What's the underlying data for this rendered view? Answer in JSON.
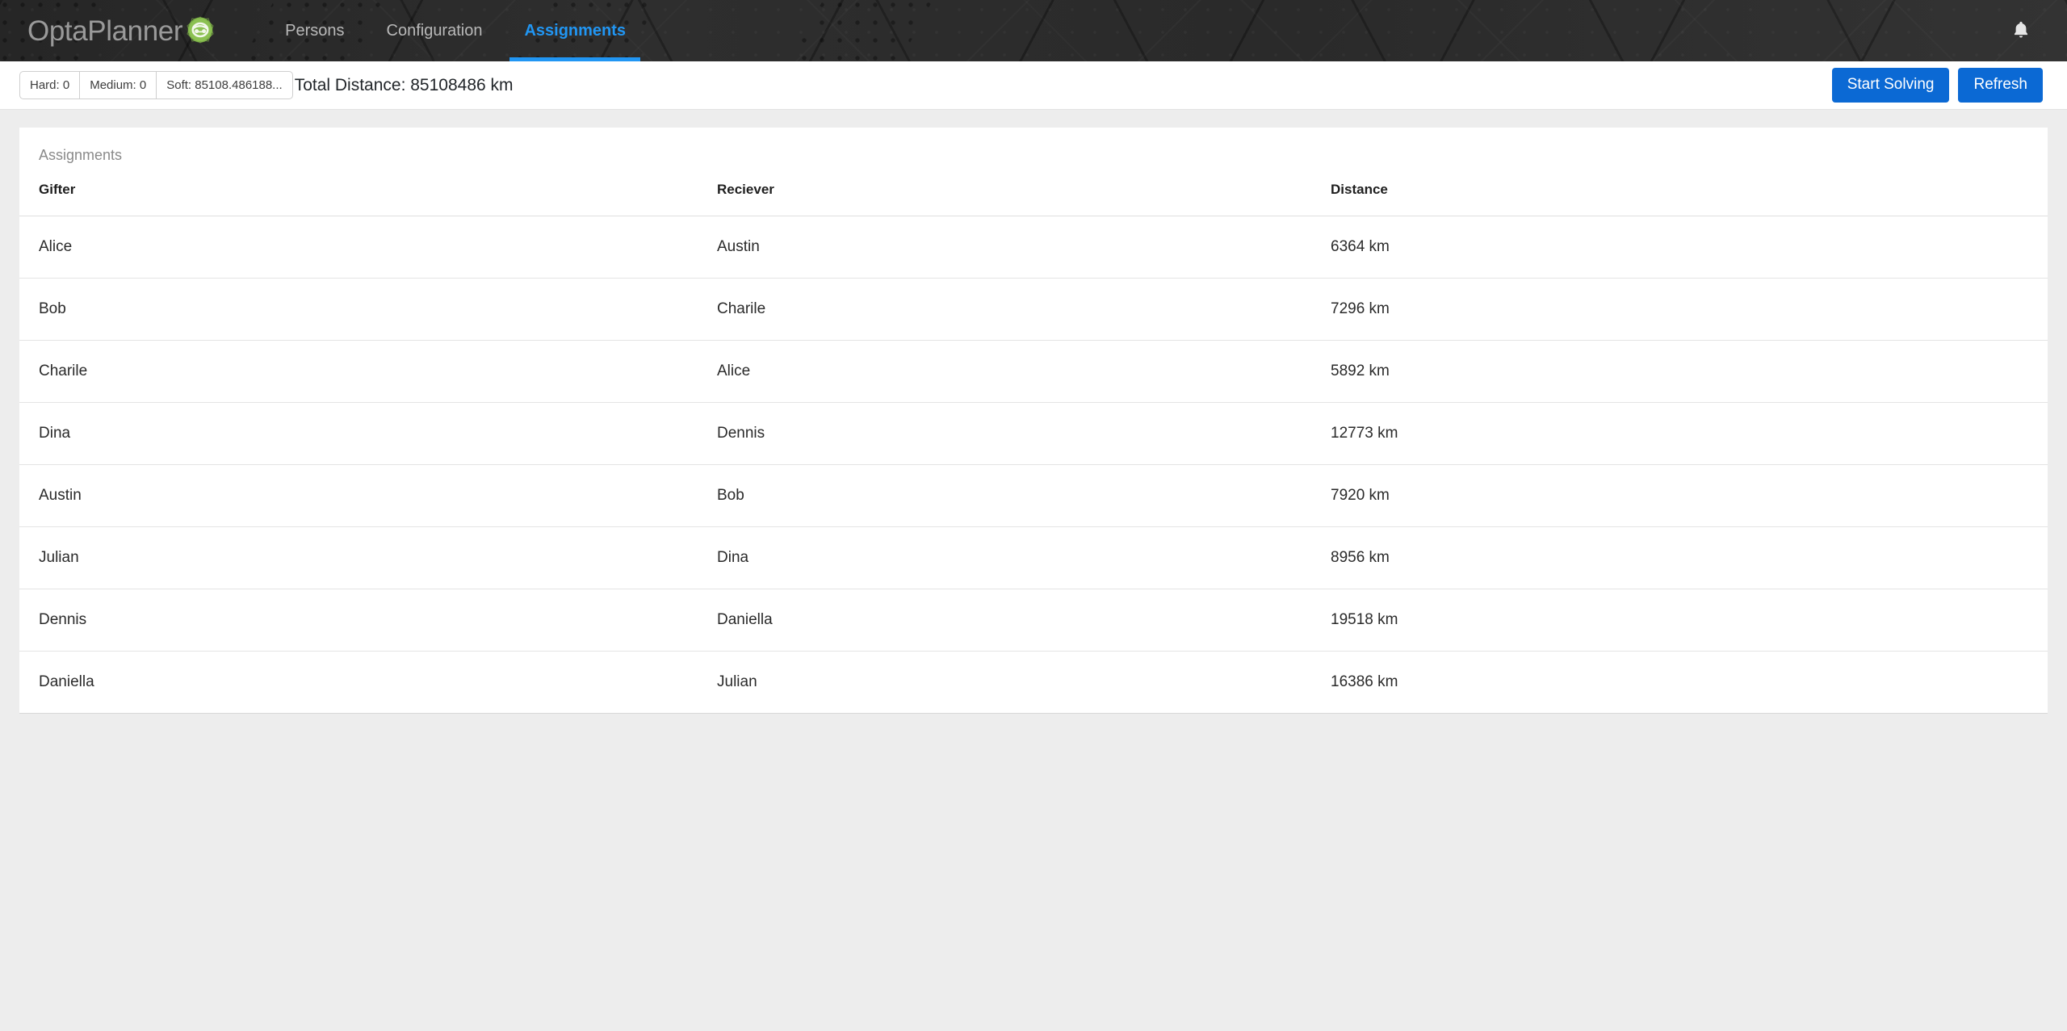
{
  "navbar": {
    "brand": {
      "text": "OptaPlanner",
      "icon": "optaplanner-leaf-logo"
    },
    "links": [
      {
        "label": "Persons",
        "active": false
      },
      {
        "label": "Configuration",
        "active": false
      },
      {
        "label": "Assignments",
        "active": true
      }
    ],
    "notification_icon": "bell-icon",
    "accent_color": "#2196f3",
    "background_color": "#2b2b2b"
  },
  "toolbar": {
    "score": [
      {
        "label": "Hard: 0"
      },
      {
        "label": "Medium: 0"
      },
      {
        "label": "Soft: 85108.486188..."
      }
    ],
    "total_distance": "Total Distance: 85108486 km",
    "start_solving_label": "Start Solving",
    "refresh_label": "Refresh",
    "button_color": "#0b69d4"
  },
  "card": {
    "title": "Assignments",
    "columns": [
      "Gifter",
      "Reciever",
      "Distance"
    ],
    "rows": [
      {
        "gifter": "Alice",
        "receiver": "Austin",
        "distance": "6364 km"
      },
      {
        "gifter": "Bob",
        "receiver": "Charile",
        "distance": "7296 km"
      },
      {
        "gifter": "Charile",
        "receiver": "Alice",
        "distance": "5892 km"
      },
      {
        "gifter": "Dina",
        "receiver": "Dennis",
        "distance": "12773 km"
      },
      {
        "gifter": "Austin",
        "receiver": "Bob",
        "distance": "7920 km"
      },
      {
        "gifter": "Julian",
        "receiver": "Dina",
        "distance": "8956 km"
      },
      {
        "gifter": "Dennis",
        "receiver": "Daniella",
        "distance": "19518 km"
      },
      {
        "gifter": "Daniella",
        "receiver": "Julian",
        "distance": "16386 km"
      }
    ]
  }
}
